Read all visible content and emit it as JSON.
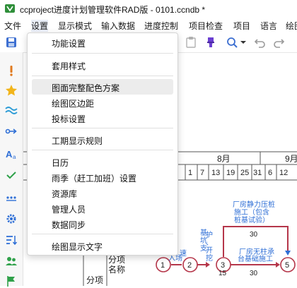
{
  "window": {
    "title": "ccproject进度计划管理软件RAD版 - 0101.ccndb *"
  },
  "menubar": {
    "items": [
      {
        "label": "文件"
      },
      {
        "label": "设置"
      },
      {
        "label": "显示模式"
      },
      {
        "label": "输入数据"
      },
      {
        "label": "进度控制"
      },
      {
        "label": "项目检查"
      },
      {
        "label": "项目"
      },
      {
        "label": "语言"
      },
      {
        "label": "绘图"
      }
    ]
  },
  "toolbar": {
    "icons": [
      "save-icon",
      "paste-icon",
      "highlighter-icon",
      "search-icon",
      "undo-icon",
      "redo-icon"
    ]
  },
  "sidebar": {
    "icons": [
      "notebook-icon",
      "alert-icon",
      "star-icon",
      "wave-icon",
      "link-arrow-icon",
      "font-size-icon",
      "check-icon",
      "dots-icon",
      "gear-icon",
      "sort-icon",
      "people-icon",
      "flag-icon"
    ]
  },
  "settings_menu": {
    "items": [
      {
        "label": "功能设置"
      },
      {
        "label": "套用样式"
      },
      {
        "label": "图面完整配色方案"
      },
      {
        "label": "绘图区边距"
      },
      {
        "label": "投标设置"
      },
      {
        "label": "工期显示规则"
      },
      {
        "label": "日历"
      },
      {
        "label": "雨季（赶工加班）设置"
      },
      {
        "label": "资源库"
      },
      {
        "label": "管理人员"
      },
      {
        "label": "数据同步"
      },
      {
        "label": "绘图显示文字"
      }
    ]
  },
  "timescale": {
    "month_labels": [
      "8月",
      "9月"
    ],
    "day_labels": [
      "1",
      "7",
      "13",
      "19",
      "25",
      "31",
      "6",
      "12"
    ]
  },
  "network": {
    "table_headers": [
      "分项名称",
      "分项"
    ],
    "nodes": [
      "1",
      "2",
      "3",
      "5"
    ],
    "activity_labels": [
      "入场",
      "基坑支护、开挖",
      "厂房静力压桩施工（包含桩基试验）",
      "厂房无柱承台基础施工"
    ],
    "durations": [
      "15",
      "30",
      "30"
    ],
    "fragment_label": "速"
  },
  "colors": {
    "accent": "#2f6fd6",
    "arrow_red": "#b5364a",
    "hover": "#ececec"
  }
}
